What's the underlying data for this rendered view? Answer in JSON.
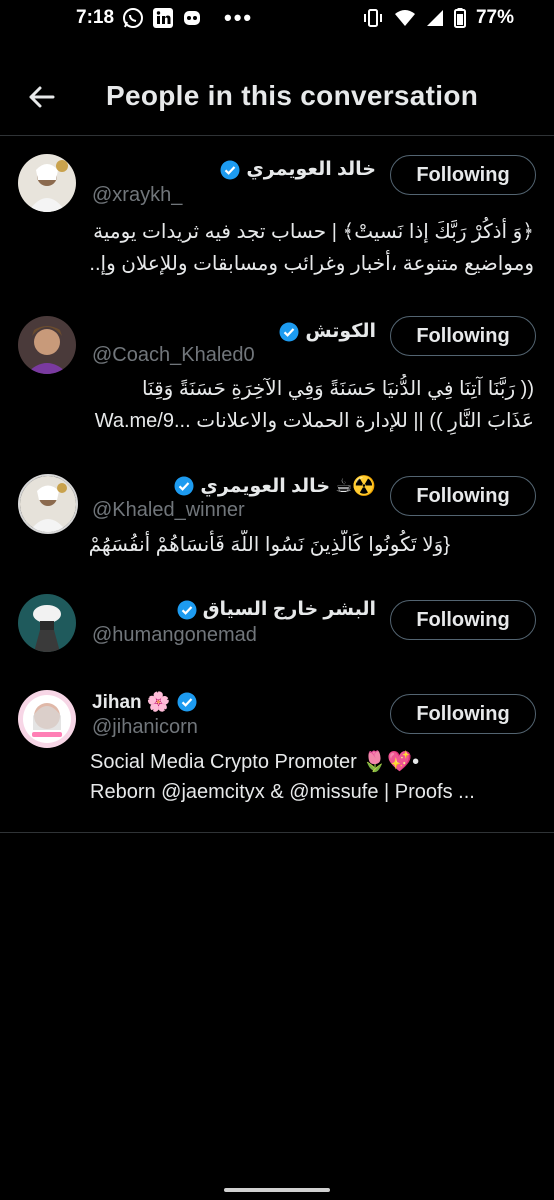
{
  "status_bar": {
    "time": "7:18",
    "battery": "77%",
    "icons": [
      "whatsapp-icon",
      "linkedin-icon",
      "app-icon",
      "vibrate-icon",
      "wifi-icon",
      "signal-icon",
      "battery-icon"
    ]
  },
  "header": {
    "title": "People in this conversation",
    "back_icon": "arrow-left-icon"
  },
  "colors": {
    "background": "#000000",
    "text": "#e7e9ea",
    "secondary_text": "#71767b",
    "verified": "#1d9bf0",
    "divider": "#2f3336"
  },
  "people": [
    {
      "name": "خالد العويمري",
      "handle": "@xraykh_",
      "bio": [
        "﴿وَ أذكُرْ رَبَّكَ إذا نَسيتْ﴾ | حساب تجد فيه ثريدات يومية",
        "ومواضيع متنوعة ،أخبار وغرائب ومسابقات وللإعلان وإ..."
      ],
      "follow_label": "Following"
    },
    {
      "name": "الكوتش",
      "handle": "@Coach_Khaled0",
      "bio": [
        "(( رَبَّنَا آتِنَا فِي الدُّنيَا حَسَنَةً وَفِي الآخِرَةِ حَسَنَةً وَقِنَا",
        "عَذَابَ النَّارِ )) || للإدارة الحملات والاعلانات ...Wa.me/9"
      ],
      "follow_label": "Following"
    },
    {
      "name": "خالد العويمري ☕☢️",
      "handle": "@Khaled_winner",
      "bio": [
        "{وَلا تَكُونُوا كَالَّذِينَ نَسُوا اللَّهَ فَأَنسَاهُمْ أَنفُسَهُمْ}"
      ],
      "follow_label": "Following"
    },
    {
      "name": "البشر خارج السياق",
      "handle": "@humangonemad",
      "bio": [],
      "follow_label": "Following"
    },
    {
      "name": "Jihan 🌸",
      "handle": "@jihanicorn",
      "bio": [
        "Social Media Crypto Promoter 🌷💖•",
        "Reborn @jaemcityx & @missufe | Proofs ..."
      ],
      "follow_label": "Following"
    }
  ]
}
